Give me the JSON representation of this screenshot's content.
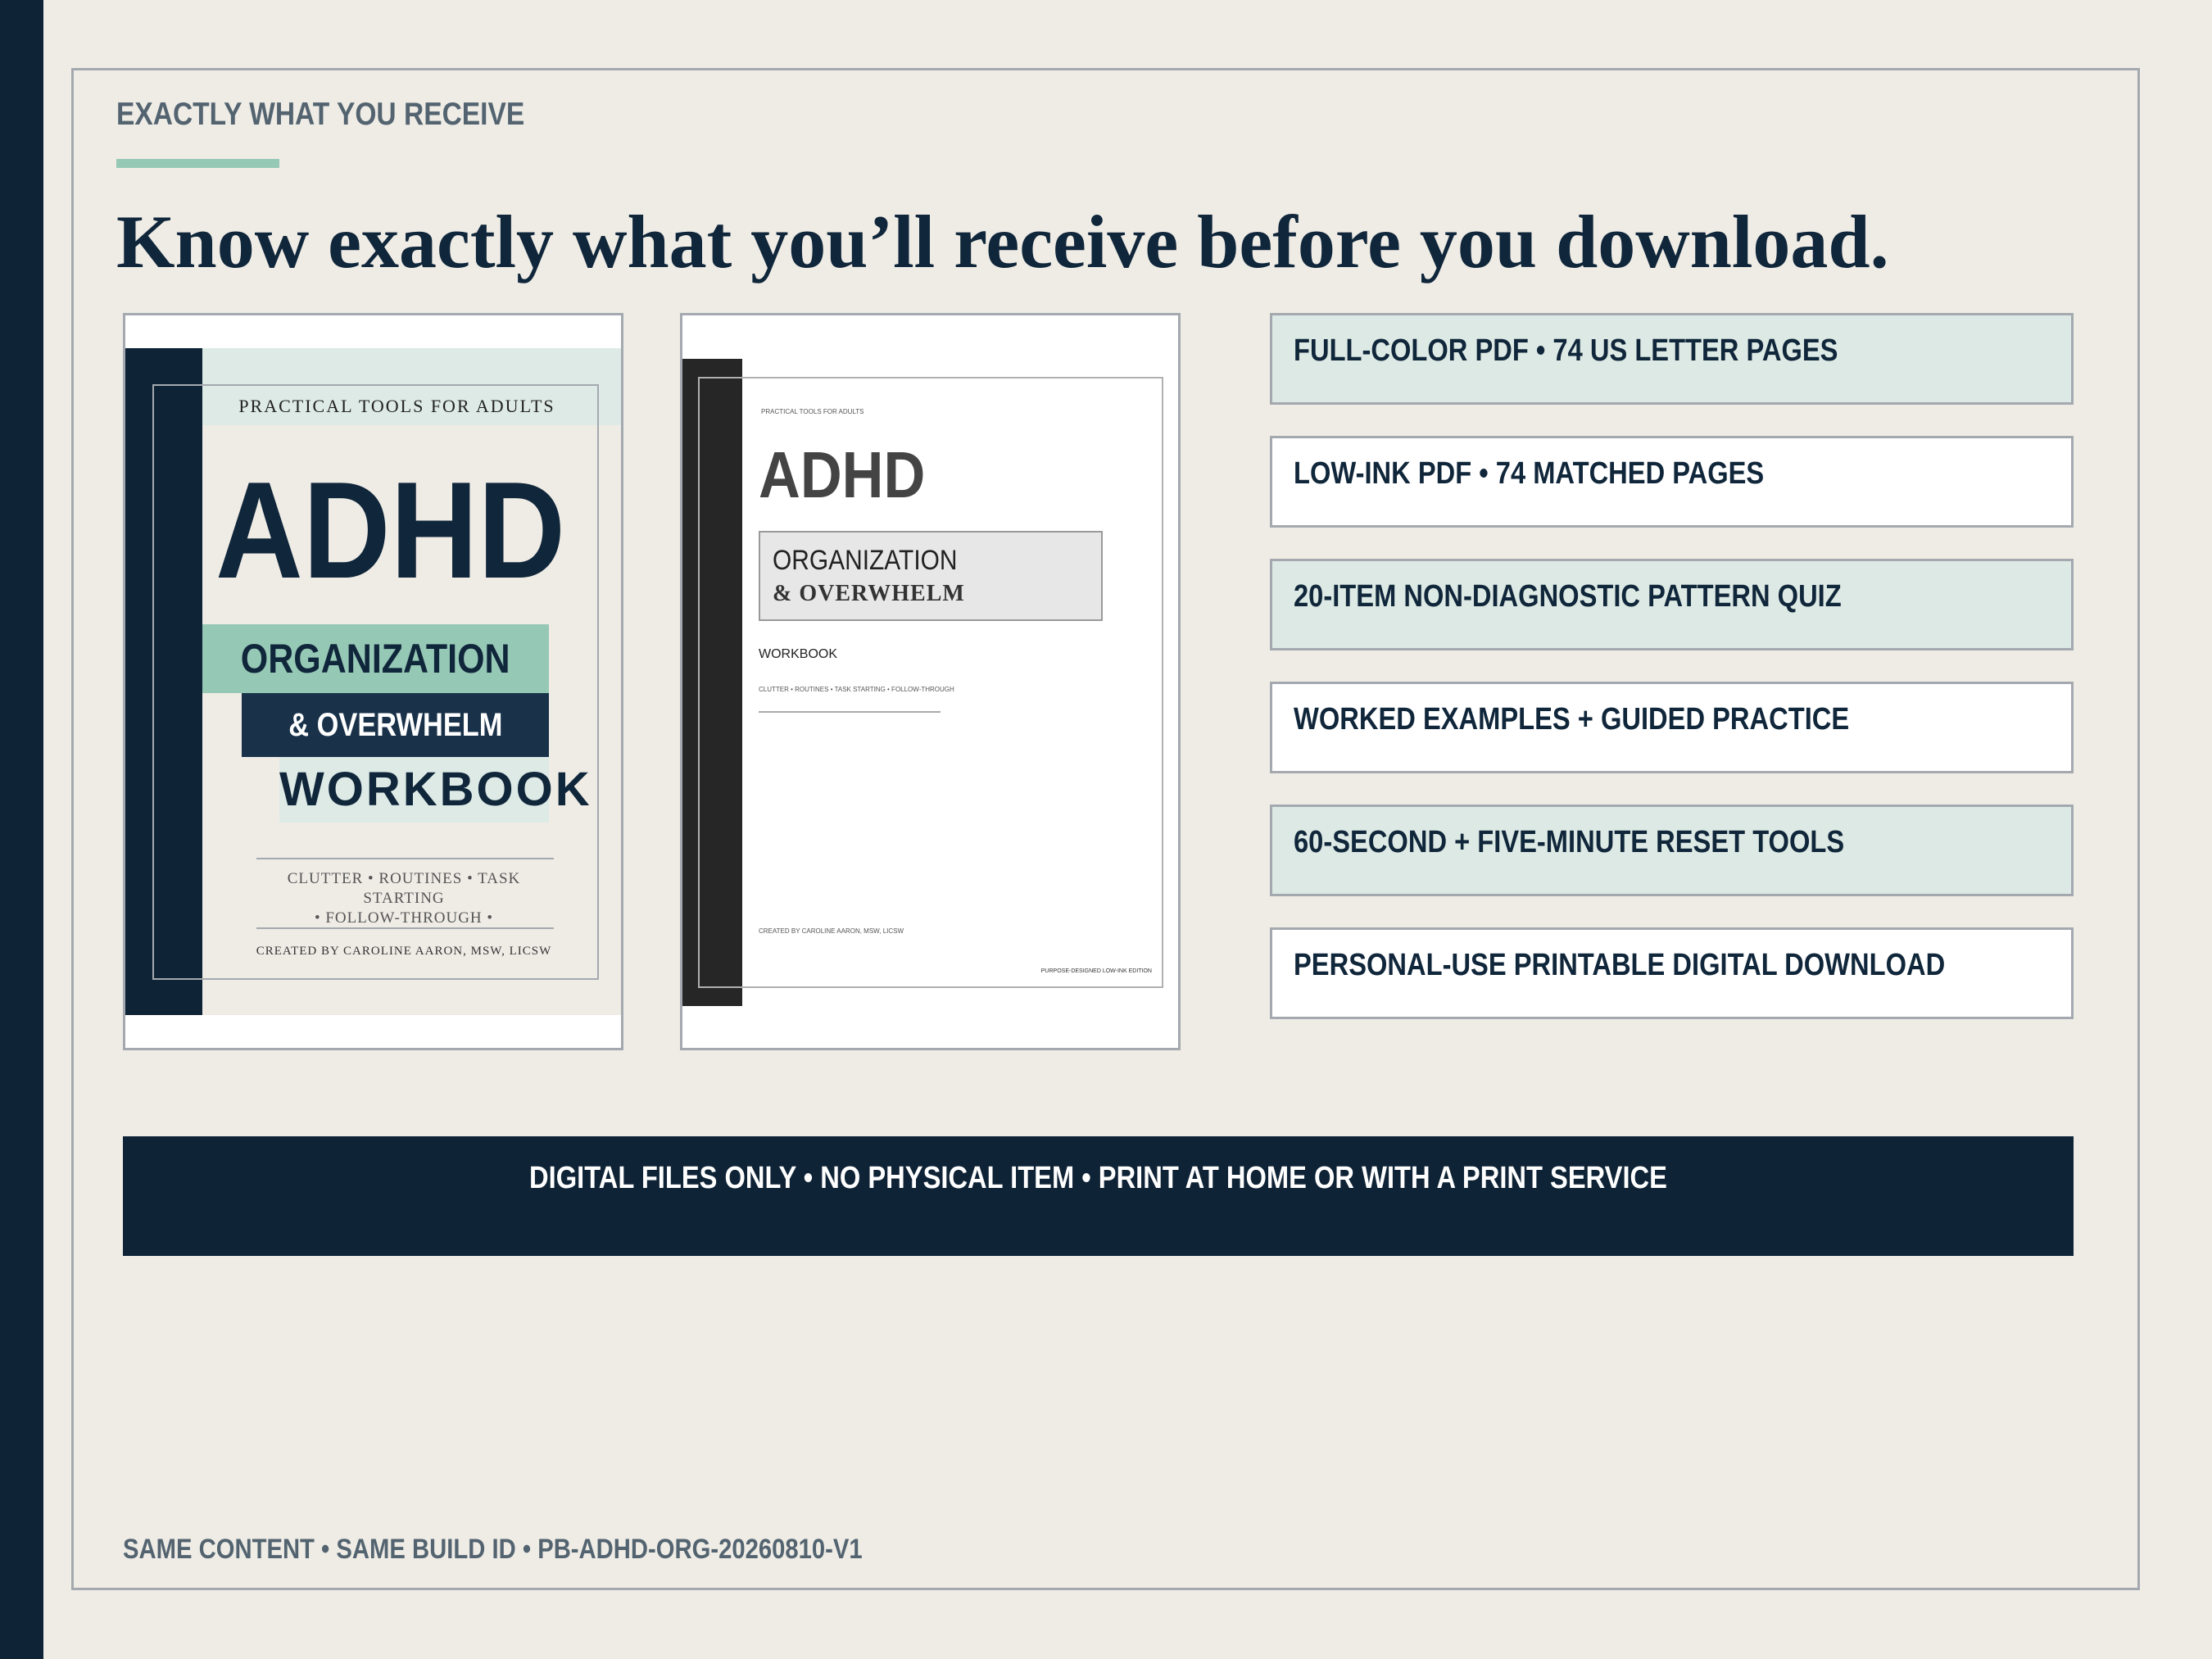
{
  "header": {
    "eyebrow": "EXACTLY WHAT YOU RECEIVE",
    "headline": "Know exactly what you’ll receive before you download."
  },
  "cover_full_color": {
    "eyebrow": "PRACTICAL TOOLS FOR ADULTS",
    "title": "ADHD",
    "subtitle_1": "ORGANIZATION",
    "subtitle_2": "& OVERWHELM",
    "subtitle_3": "WORKBOOK",
    "topics_line_1": "CLUTTER • ROUTINES • TASK STARTING",
    "topics_line_2": "• FOLLOW-THROUGH •",
    "credit": "CREATED BY CAROLINE AARON, MSW, LICSW"
  },
  "cover_low_ink": {
    "eyebrow": "PRACTICAL TOOLS FOR ADULTS",
    "title": "ADHD",
    "subtitle_1": "ORGANIZATION",
    "subtitle_2": "& OVERWHELM",
    "subtitle_3": "WORKBOOK",
    "topics": "CLUTTER • ROUTINES • TASK STARTING • FOLLOW-THROUGH",
    "credit": "CREATED BY CAROLINE AARON, MSW, LICSW",
    "edition": "PURPOSE-DESIGNED LOW-INK EDITION"
  },
  "features": [
    "FULL-COLOR PDF • 74 US LETTER PAGES",
    "LOW-INK PDF • 74 MATCHED PAGES",
    "20-ITEM NON-DIAGNOSTIC PATTERN QUIZ",
    "WORKED EXAMPLES + GUIDED PRACTICE",
    "60-SECOND + FIVE-MINUTE RESET TOOLS",
    "PERSONAL-USE PRINTABLE DIGITAL DOWNLOAD"
  ],
  "banner": "DIGITAL FILES ONLY • NO PHYSICAL ITEM • PRINT AT HOME OR WITH A PRINT SERVICE",
  "footer": "SAME CONTENT • SAME BUILD ID • PB-ADHD-ORG-20260810-V1",
  "colors": {
    "navy": "#0f2336",
    "mint": "#96c8b6",
    "mint_light": "#dde9e4",
    "background": "#efece6"
  }
}
